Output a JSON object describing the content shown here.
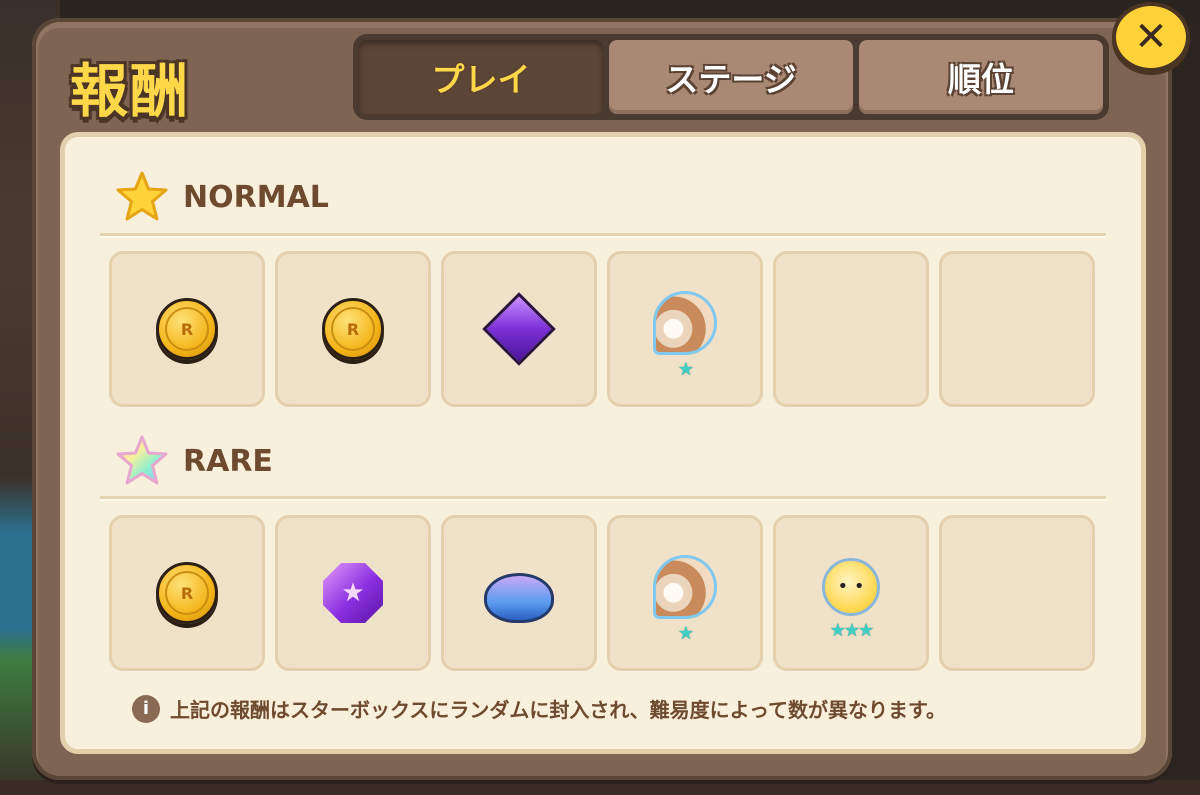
{
  "dialog": {
    "title": "報酬"
  },
  "tabs": [
    {
      "label": "プレイ",
      "active": true
    },
    {
      "label": "ステージ",
      "active": false
    },
    {
      "label": "順位",
      "active": false
    }
  ],
  "close_icon": "close-icon",
  "sections": {
    "normal": {
      "label": "NORMAL",
      "icon": "gold-star-icon",
      "items": [
        {
          "icon": "gold-coin-icon",
          "coin_letter": "R"
        },
        {
          "icon": "gold-coin-icon",
          "coin_letter": "R"
        },
        {
          "icon": "purple-diamond-gem-icon"
        },
        {
          "icon": "shell-treasure-icon",
          "stars": "★"
        },
        {
          "icon": "empty"
        },
        {
          "icon": "empty"
        }
      ]
    },
    "rare": {
      "label": "RARE",
      "icon": "rainbow-star-icon",
      "items": [
        {
          "icon": "gold-coin-icon",
          "coin_letter": "R"
        },
        {
          "icon": "purple-octagon-gem-icon"
        },
        {
          "icon": "blue-bunny-slime-icon"
        },
        {
          "icon": "shell-treasure-icon",
          "stars": "★"
        },
        {
          "icon": "sally-bulb-treasure-icon",
          "stars": "★★★"
        },
        {
          "icon": "empty"
        }
      ]
    }
  },
  "footer_note": "上記の報酬はスターボックスにランダムに封入され、難易度によって数が異なります。",
  "colors": {
    "title": "#ffd84a",
    "frame": "#7e6553",
    "panel": "#f8efdc",
    "slot": "#f0e2c8",
    "text_brown": "#6e4a2e",
    "tab_active": "#5c4637",
    "tab_inactive": "#a98975"
  }
}
